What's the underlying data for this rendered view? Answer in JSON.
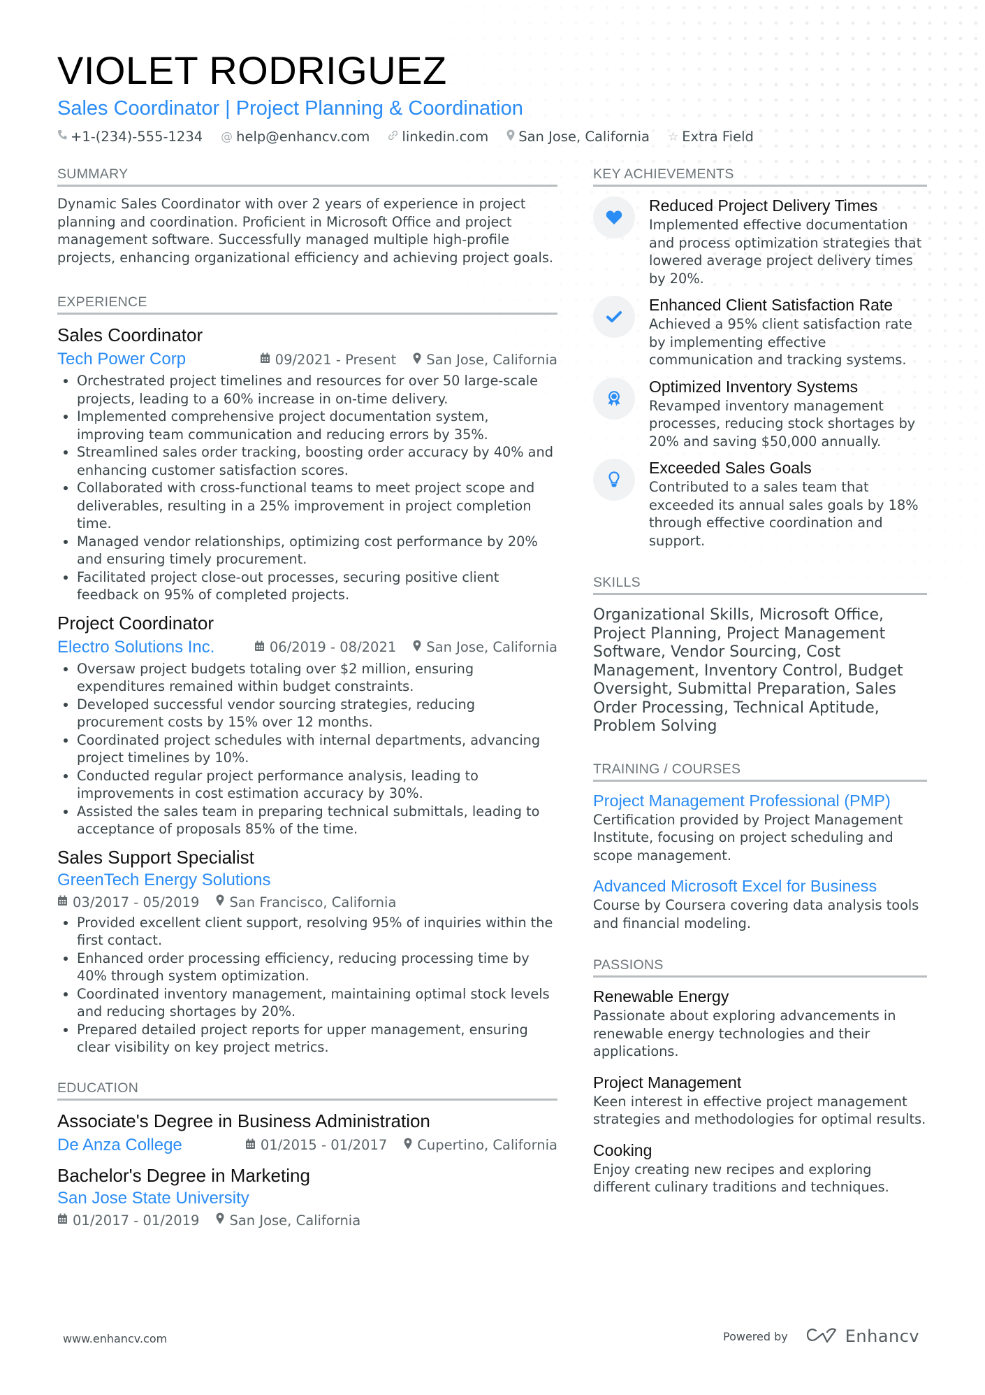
{
  "header": {
    "name": "VIOLET RODRIGUEZ",
    "title": "Sales Coordinator | Project Planning & Coordination",
    "contacts": [
      {
        "icon": "phone-icon",
        "glyph": "☎",
        "text": "+1-(234)-555-1234"
      },
      {
        "icon": "at-icon",
        "glyph": "@",
        "text": "help@enhancv.com"
      },
      {
        "icon": "link-icon",
        "glyph": "🔗",
        "text": "linkedin.com"
      },
      {
        "icon": "location-pin-icon",
        "glyph": "●",
        "text": "San Jose, California"
      },
      {
        "icon": "star-icon",
        "glyph": "☆",
        "text": "Extra Field"
      }
    ]
  },
  "summary": {
    "heading": "SUMMARY",
    "text": "Dynamic Sales Coordinator with over 2 years of experience in project planning and coordination. Proficient in Microsoft Office and project management software. Successfully managed multiple high-profile projects, enhancing organizational efficiency and achieving project goals."
  },
  "experience": {
    "heading": "EXPERIENCE",
    "jobs": [
      {
        "title": "Sales Coordinator",
        "company": "Tech Power Corp",
        "dates": "09/2021 - Present",
        "location": "San Jose, California",
        "bullets": [
          "Orchestrated project timelines and resources for over 50 large-scale projects, leading to a 60% increase in on-time delivery.",
          "Implemented comprehensive project documentation system, improving team communication and reducing errors by 35%.",
          "Streamlined sales order tracking, boosting order accuracy by 40% and enhancing customer satisfaction scores.",
          "Collaborated with cross-functional teams to meet project scope and deliverables, resulting in a 25% improvement in project completion time.",
          "Managed vendor relationships, optimizing cost performance by 20% and ensuring timely procurement.",
          "Facilitated project close-out processes, securing positive client feedback on 95% of completed projects."
        ]
      },
      {
        "title": "Project Coordinator",
        "company": "Electro Solutions Inc.",
        "dates": "06/2019 - 08/2021",
        "location": "San Jose, California",
        "bullets": [
          "Oversaw project budgets totaling over $2 million, ensuring expenditures remained within budget constraints.",
          "Developed successful vendor sourcing strategies, reducing procurement costs by 15% over 12 months.",
          "Coordinated project schedules with internal departments, advancing project timelines by 10%.",
          "Conducted regular project performance analysis, leading to improvements in cost estimation accuracy by 30%.",
          "Assisted the sales team in preparing technical submittals, leading to acceptance of proposals 85% of the time."
        ]
      },
      {
        "title": "Sales Support Specialist",
        "company": "GreenTech Energy Solutions",
        "dates": "03/2017 - 05/2019",
        "location": "San Francisco, California",
        "bullets": [
          "Provided excellent client support, resolving 95% of inquiries within the first contact.",
          "Enhanced order processing efficiency, reducing processing time by 40% through system optimization.",
          "Coordinated inventory management, maintaining optimal stock levels and reducing shortages by 20%.",
          "Prepared detailed project reports for upper management, ensuring clear visibility on key project metrics."
        ]
      }
    ]
  },
  "education": {
    "heading": "EDUCATION",
    "items": [
      {
        "degree": "Associate's Degree in Business Administration",
        "school": "De Anza College",
        "dates": "01/2015 - 01/2017",
        "location": "Cupertino, California"
      },
      {
        "degree": "Bachelor's Degree in Marketing",
        "school": "San Jose State University",
        "dates": "01/2017 - 01/2019",
        "location": "San Jose, California"
      }
    ]
  },
  "achievements": {
    "heading": "KEY ACHIEVEMENTS",
    "items": [
      {
        "icon": "heart-icon",
        "title": "Reduced Project Delivery Times",
        "desc": "Implemented effective documentation and process optimization strategies that lowered average project delivery times by 20%."
      },
      {
        "icon": "checkmark-icon",
        "title": "Enhanced Client Satisfaction Rate",
        "desc": "Achieved a 95% client satisfaction rate by implementing effective communication and tracking systems."
      },
      {
        "icon": "award-ribbon-icon",
        "title": "Optimized Inventory Systems",
        "desc": "Revamped inventory management processes, reducing stock shortages by 20% and saving $50,000 annually."
      },
      {
        "icon": "lightbulb-icon",
        "title": "Exceeded Sales Goals",
        "desc": "Contributed to a sales team that exceeded its annual sales goals by 18% through effective coordination and support."
      }
    ]
  },
  "skills": {
    "heading": "SKILLS",
    "text": "Organizational Skills, Microsoft Office, Project Planning, Project Management Software, Vendor Sourcing, Cost Management, Inventory Control, Budget Oversight, Submittal Preparation, Sales Order Processing, Technical Aptitude, Problem Solving"
  },
  "training": {
    "heading": "TRAINING / COURSES",
    "items": [
      {
        "title": "Project Management Professional (PMP)",
        "desc": "Certification provided by Project Management Institute, focusing on project scheduling and scope management."
      },
      {
        "title": "Advanced Microsoft Excel for Business",
        "desc": "Course by Coursera covering data analysis tools and financial modeling."
      }
    ]
  },
  "passions": {
    "heading": "PASSIONS",
    "items": [
      {
        "title": "Renewable Energy",
        "desc": "Passionate about exploring advancements in renewable energy technologies and their applications."
      },
      {
        "title": "Project Management",
        "desc": "Keen interest in effective project management strategies and methodologies for optimal results."
      },
      {
        "title": "Cooking",
        "desc": "Enjoy creating new recipes and exploring different culinary traditions and techniques."
      }
    ]
  },
  "footer": {
    "website": "www.enhancv.com",
    "powered_by": "Powered by",
    "brand": "Enhancv"
  },
  "colors": {
    "accent": "#2a8cf5",
    "text": "#3a4549",
    "heading": "#6b7478",
    "rule": "#b9bdbf"
  }
}
